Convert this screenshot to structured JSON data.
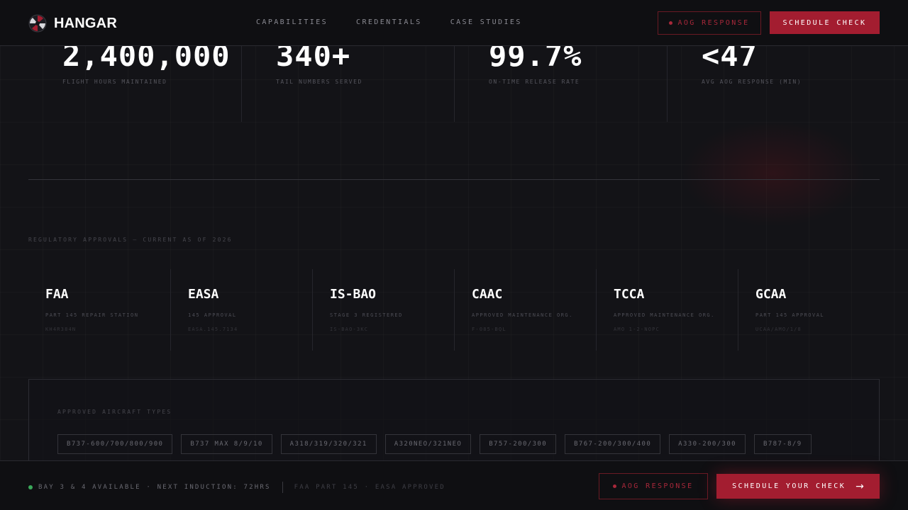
{
  "brand": {
    "name": "HANGAR",
    "accent": "#a31d30",
    "status_color": "#3aa85a"
  },
  "nav": {
    "links": [
      "CAPABILITIES",
      "CREDENTIALS",
      "CASE STUDIES"
    ],
    "aog_label": "AOG RESPONSE",
    "schedule_label": "SCHEDULE CHECK"
  },
  "stats": [
    {
      "value": "2,400,000",
      "label": "FLIGHT HOURS MAINTAINED"
    },
    {
      "value": "340+",
      "label": "TAIL NUMBERS SERVED"
    },
    {
      "value": "99.7%",
      "label": "ON-TIME RELEASE RATE"
    },
    {
      "value": "<47",
      "label": "AVG AOG RESPONSE (MIN)"
    }
  ],
  "approvals_section": {
    "label": "REGULATORY APPROVALS — CURRENT AS OF 2026",
    "items": [
      {
        "name": "FAA",
        "desc": "PART 145 REPAIR STATION",
        "code": "KH4R384N"
      },
      {
        "name": "EASA",
        "desc": "145 APPROVAL",
        "code": "EASA.145.7134"
      },
      {
        "name": "IS-BAO",
        "desc": "STAGE 3 REGISTERED",
        "code": "IS-BAO-3KC"
      },
      {
        "name": "CAAC",
        "desc": "APPROVED MAINTENANCE ORG.",
        "code": "F-085-BQL"
      },
      {
        "name": "TCCA",
        "desc": "APPROVED MAINTENANCE ORG.",
        "code": "AMO 1-2-NOPC"
      },
      {
        "name": "GCAA",
        "desc": "PART 145 APPROVAL",
        "code": "UCAA/AMO/1/8"
      }
    ]
  },
  "aircraft": {
    "title": "APPROVED AIRCRAFT TYPES",
    "types": [
      "B737-600/700/800/900",
      "B737 MAX 8/9/10",
      "A318/319/320/321",
      "A320NEO/321NEO",
      "B757-200/300",
      "B767-200/300/400",
      "A330-200/300",
      "B787-8/9"
    ]
  },
  "footer": {
    "status": "BAY 3 & 4 AVAILABLE · NEXT INDUCTION: 72HRS",
    "approvals": "FAA PART 145 · EASA APPROVED",
    "aog_label": "AOG RESPONSE",
    "schedule_label": "SCHEDULE YOUR CHECK",
    "arrow": "→"
  }
}
